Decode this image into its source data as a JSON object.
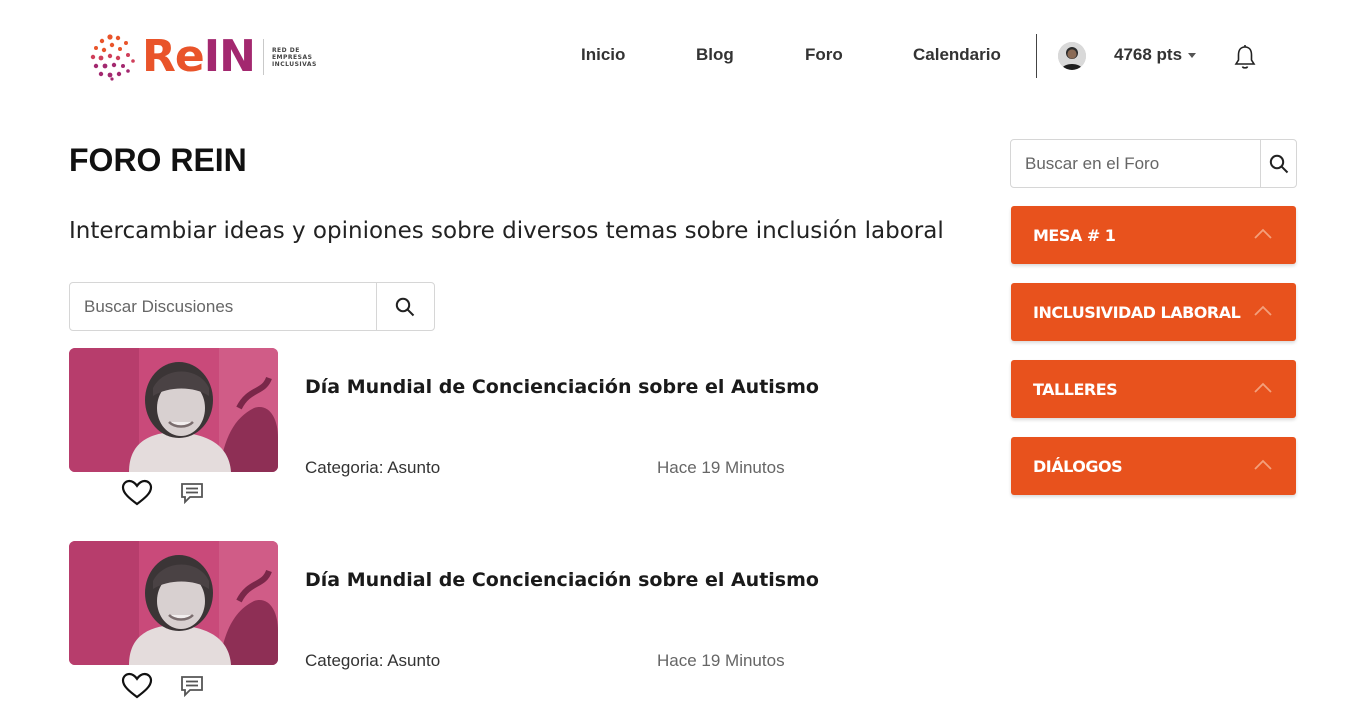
{
  "header": {
    "logo": {
      "name_part1": "Re",
      "name_part2": "IN",
      "subtitle": [
        "RED DE",
        "EMPRESAS",
        "INCLUSIVAS"
      ]
    },
    "nav": [
      {
        "label": "Inicio"
      },
      {
        "label": "Blog"
      },
      {
        "label": "Foro"
      },
      {
        "label": "Calendario"
      }
    ],
    "user": {
      "points": "4768 pts",
      "avatar_icon": "user-avatar",
      "notifications_icon": "bell-icon"
    }
  },
  "main": {
    "title": "FORO REIN",
    "subtitle": "Intercambiar ideas y opiniones sobre diversos temas sobre inclusión laboral",
    "search": {
      "placeholder": "Buscar Discusiones",
      "icon": "search-icon"
    },
    "posts": [
      {
        "title": "Día Mundial de Concienciación sobre el Autismo",
        "category": "Categoria: Asunto",
        "time": "Hace 19 Minutos",
        "icons": [
          "heart-icon",
          "comment-icon"
        ]
      },
      {
        "title": "Día Mundial de Concienciación sobre el Autismo",
        "category": "Categoria: Asunto",
        "time": "Hace 19 Minutos",
        "icons": [
          "heart-icon",
          "comment-icon"
        ]
      }
    ]
  },
  "sidebar": {
    "search": {
      "placeholder": "Buscar en el Foro",
      "icon": "search-icon"
    },
    "sections": [
      {
        "label": "MESA # 1"
      },
      {
        "label": "INCLUSIVIDAD LABORAL"
      },
      {
        "label": "TALLERES"
      },
      {
        "label": "DIÁLOGOS"
      }
    ]
  },
  "colors": {
    "accent": "#e8521d",
    "brand_orange": "#e9542a",
    "brand_purple": "#a3286f",
    "thumb_pink": "#c94a7a"
  }
}
